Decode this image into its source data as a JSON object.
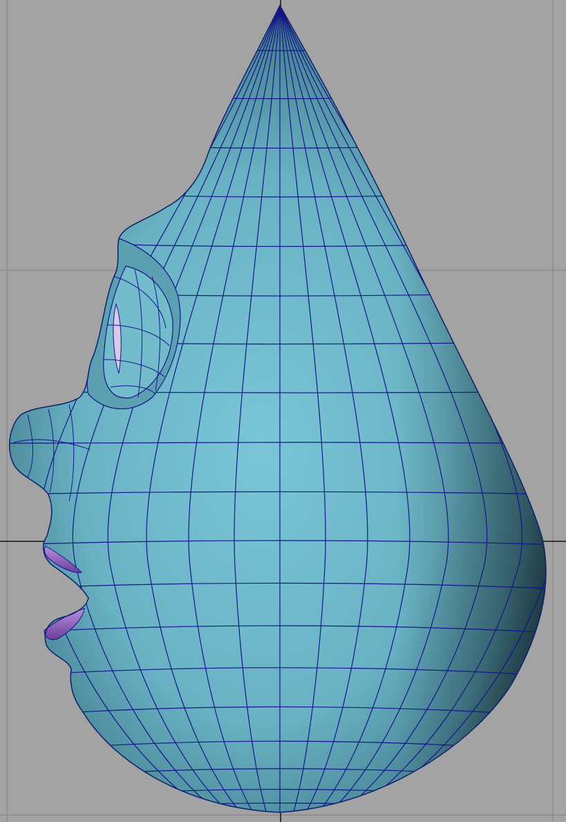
{
  "viewport": {
    "background_color": "#a3a3a3",
    "grid_line_color": "#8a8a8a",
    "axis_line_color": "#000000"
  },
  "model": {
    "description_icon": "3d-head-mesh-icon",
    "surface_color": "#6fb9c9",
    "surface_shadow_color": "#1d2d33",
    "wireframe_color": "#14148c",
    "lip_color": "#8a5ab8"
  }
}
